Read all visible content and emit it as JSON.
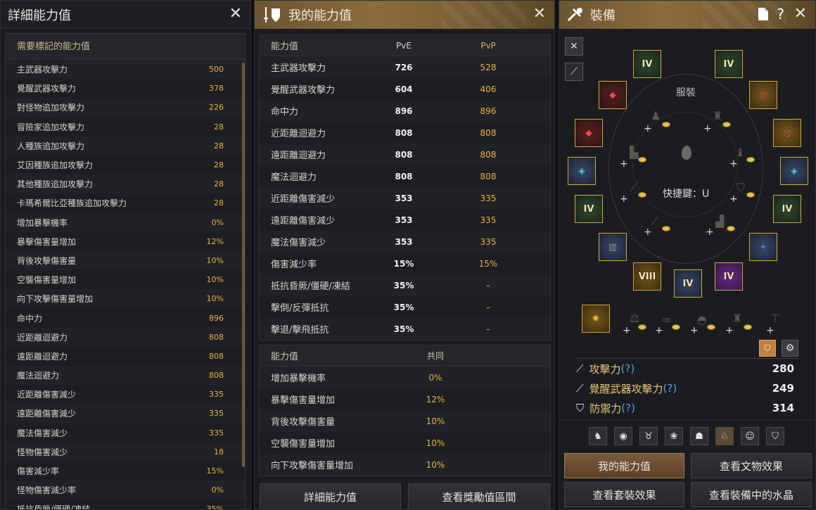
{
  "p1": {
    "title": "詳細能力值",
    "section": "需要標記的能力值",
    "rows": [
      {
        "l": "主武器攻擊力",
        "v": "500"
      },
      {
        "l": "覺醒武器攻擊力",
        "v": "378"
      },
      {
        "l": "對怪物追加攻擊力",
        "v": "226"
      },
      {
        "l": "冒險家追加攻擊力",
        "v": "28"
      },
      {
        "l": "人種族追加攻擊力",
        "v": "28"
      },
      {
        "l": "艾因種族追加攻擊力",
        "v": "28"
      },
      {
        "l": "其他種族追加攻擊力",
        "v": "28"
      },
      {
        "l": "卡瑪希爾比亞種族追加攻擊力",
        "v": "28"
      },
      {
        "l": "增加暴擊機率",
        "v": "0%"
      },
      {
        "l": "暴擊傷害量增加",
        "v": "12%"
      },
      {
        "l": "背後攻擊傷害量",
        "v": "10%"
      },
      {
        "l": "空襲傷害量增加",
        "v": "10%"
      },
      {
        "l": "向下攻擊傷害量增加",
        "v": "10%"
      },
      {
        "l": "命中力",
        "v": "896"
      },
      {
        "l": "近距離迴避力",
        "v": "808"
      },
      {
        "l": "遠距離迴避力",
        "v": "808"
      },
      {
        "l": "魔法迴避力",
        "v": "808"
      },
      {
        "l": "近距離傷害減少",
        "v": "335"
      },
      {
        "l": "遠距離傷害減少",
        "v": "335"
      },
      {
        "l": "魔法傷害減少",
        "v": "335"
      },
      {
        "l": "怪物傷害減少",
        "v": "18"
      },
      {
        "l": "傷害減少率",
        "v": "15%"
      },
      {
        "l": "怪物傷害減少率",
        "v": "0%"
      },
      {
        "l": "抵抗昏厥/僵硬/凍結",
        "v": "35%"
      }
    ]
  },
  "p2": {
    "title": "我的能力值",
    "t1": {
      "h": [
        "能力值",
        "PvE",
        "PvP"
      ],
      "rows": [
        {
          "l": "主武器攻擊力",
          "a": "726",
          "b": "528"
        },
        {
          "l": "覺醒武器攻擊力",
          "a": "604",
          "b": "406"
        },
        {
          "l": "命中力",
          "a": "896",
          "b": "896"
        },
        {
          "l": "近距離迴避力",
          "a": "808",
          "b": "808"
        },
        {
          "l": "遠距離迴避力",
          "a": "808",
          "b": "808"
        },
        {
          "l": "魔法迴避力",
          "a": "808",
          "b": "808"
        },
        {
          "l": "近距離傷害減少",
          "a": "353",
          "b": "335"
        },
        {
          "l": "遠距離傷害減少",
          "a": "353",
          "b": "335"
        },
        {
          "l": "魔法傷害減少",
          "a": "353",
          "b": "335"
        },
        {
          "l": "傷害減少率",
          "a": "15%",
          "b": "15%"
        },
        {
          "l": "抵抗昏厥/僵硬/凍結",
          "a": "35%",
          "b": "–"
        },
        {
          "l": "擊倒/反彈抵抗",
          "a": "35%",
          "b": "–"
        },
        {
          "l": "擊退/擊飛抵抗",
          "a": "35%",
          "b": "–"
        }
      ]
    },
    "t2": {
      "h": [
        "能力值",
        "共同"
      ],
      "rows": [
        {
          "l": "增加暴擊機率",
          "v": "0%"
        },
        {
          "l": "暴擊傷害量增加",
          "v": "12%"
        },
        {
          "l": "背後攻擊傷害量",
          "v": "10%"
        },
        {
          "l": "空襲傷害量增加",
          "v": "10%"
        },
        {
          "l": "向下攻擊傷害量增加",
          "v": "10%"
        }
      ]
    },
    "btn_detail": "詳細能力值",
    "btn_reward": "查看獎勵值區間"
  },
  "p3": {
    "title": "裝備",
    "costume": "服裝",
    "hotkey": "快捷鍵：U",
    "slots": {
      "s1": "IV",
      "s2": "IV",
      "s3": "IV",
      "s4": "IV",
      "s5": "VIII",
      "s6": "IV",
      "s7": "IV"
    },
    "stats": [
      {
        "l": "攻擊力",
        "q": "(?)",
        "v": "280"
      },
      {
        "l": "覺醒武器攻擊力",
        "q": "(?)",
        "v": "249"
      },
      {
        "l": "防禦力",
        "q": "(?)",
        "v": "314"
      }
    ],
    "buttons": {
      "my": "我的能力值",
      "relic": "查看文物效果",
      "set": "查看套裝效果",
      "crystal": "查看裝備中的水晶"
    }
  }
}
